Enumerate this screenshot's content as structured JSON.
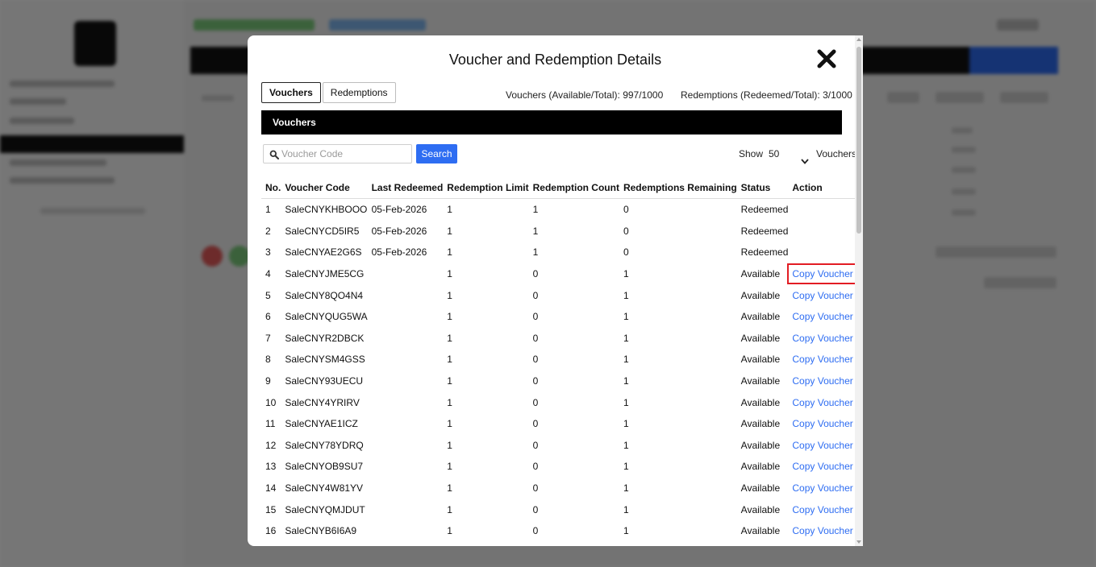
{
  "modal": {
    "title": "Voucher and Redemption Details",
    "close_icon": "close-icon",
    "tabs": [
      {
        "label": "Vouchers",
        "active": true
      },
      {
        "label": "Redemptions",
        "active": false
      }
    ],
    "summary": {
      "vouchers": "Vouchers (Available/Total): 997/1000",
      "redemptions": "Redemptions (Redeemed/Total): 3/1000"
    },
    "section_title": "Vouchers",
    "search": {
      "placeholder": "Voucher Code",
      "button_label": "Search",
      "icon": "search-icon"
    },
    "show": {
      "label": "Show",
      "value": "50",
      "suffix": "Vouchers"
    },
    "table": {
      "columns": [
        "No.",
        "Voucher Code",
        "Last Redeemed",
        "Redemption Limit",
        "Redemption Count",
        "Redemptions Remaining",
        "Status",
        "Action"
      ],
      "rows": [
        {
          "no": "1",
          "code": "SaleCNYKHBOOO",
          "last": "05-Feb-2026",
          "limit": "1",
          "count": "1",
          "remaining": "0",
          "status": "Redeemed",
          "action": ""
        },
        {
          "no": "2",
          "code": "SaleCNYCD5IR5",
          "last": "05-Feb-2026",
          "limit": "1",
          "count": "1",
          "remaining": "0",
          "status": "Redeemed",
          "action": ""
        },
        {
          "no": "3",
          "code": "SaleCNYAE2G6S",
          "last": "05-Feb-2026",
          "limit": "1",
          "count": "1",
          "remaining": "0",
          "status": "Redeemed",
          "action": ""
        },
        {
          "no": "4",
          "code": "SaleCNYJME5CG",
          "last": "",
          "limit": "1",
          "count": "0",
          "remaining": "1",
          "status": "Available",
          "action": "Copy Voucher Code"
        },
        {
          "no": "5",
          "code": "SaleCNY8QO4N4",
          "last": "",
          "limit": "1",
          "count": "0",
          "remaining": "1",
          "status": "Available",
          "action": "Copy Voucher Code"
        },
        {
          "no": "6",
          "code": "SaleCNYQUG5WA",
          "last": "",
          "limit": "1",
          "count": "0",
          "remaining": "1",
          "status": "Available",
          "action": "Copy Voucher Code"
        },
        {
          "no": "7",
          "code": "SaleCNYR2DBCK",
          "last": "",
          "limit": "1",
          "count": "0",
          "remaining": "1",
          "status": "Available",
          "action": "Copy Voucher Code"
        },
        {
          "no": "8",
          "code": "SaleCNYSM4GSS",
          "last": "",
          "limit": "1",
          "count": "0",
          "remaining": "1",
          "status": "Available",
          "action": "Copy Voucher Code"
        },
        {
          "no": "9",
          "code": "SaleCNY93UECU",
          "last": "",
          "limit": "1",
          "count": "0",
          "remaining": "1",
          "status": "Available",
          "action": "Copy Voucher Code"
        },
        {
          "no": "10",
          "code": "SaleCNY4YRIRV",
          "last": "",
          "limit": "1",
          "count": "0",
          "remaining": "1",
          "status": "Available",
          "action": "Copy Voucher Code"
        },
        {
          "no": "11",
          "code": "SaleCNYAE1ICZ",
          "last": "",
          "limit": "1",
          "count": "0",
          "remaining": "1",
          "status": "Available",
          "action": "Copy Voucher Code"
        },
        {
          "no": "12",
          "code": "SaleCNY78YDRQ",
          "last": "",
          "limit": "1",
          "count": "0",
          "remaining": "1",
          "status": "Available",
          "action": "Copy Voucher Code"
        },
        {
          "no": "13",
          "code": "SaleCNYOB9SU7",
          "last": "",
          "limit": "1",
          "count": "0",
          "remaining": "1",
          "status": "Available",
          "action": "Copy Voucher Code"
        },
        {
          "no": "14",
          "code": "SaleCNY4W81YV",
          "last": "",
          "limit": "1",
          "count": "0",
          "remaining": "1",
          "status": "Available",
          "action": "Copy Voucher Code"
        },
        {
          "no": "15",
          "code": "SaleCNYQMJDUT",
          "last": "",
          "limit": "1",
          "count": "0",
          "remaining": "1",
          "status": "Available",
          "action": "Copy Voucher Code"
        },
        {
          "no": "16",
          "code": "SaleCNYB6I6A9",
          "last": "",
          "limit": "1",
          "count": "0",
          "remaining": "1",
          "status": "Available",
          "action": "Copy Voucher Code"
        }
      ]
    }
  },
  "colors": {
    "accent": "#2e6df2",
    "highlight": "#e21c23",
    "overlay": "rgba(0,0,0,0.52)",
    "section_bar": "#000000"
  }
}
